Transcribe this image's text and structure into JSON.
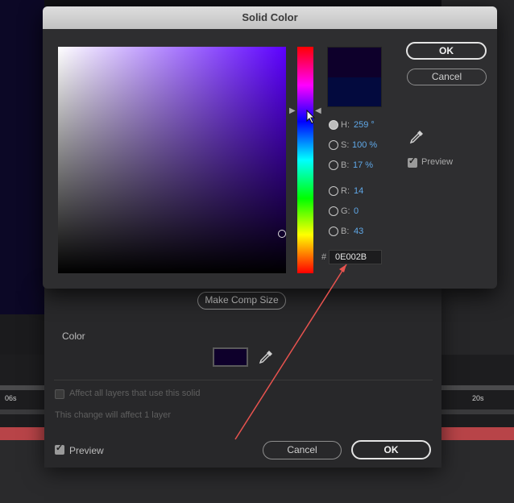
{
  "background": {
    "timeline": {
      "tick_start": "06s",
      "tick_end": "20s"
    }
  },
  "solid_settings": {
    "make_comp_size": "Make Comp Size",
    "color_label": "Color",
    "affect_all_label": "Affect all layers that use this solid",
    "change_note": "This change will affect 1 layer",
    "preview_label": "Preview",
    "cancel_label": "Cancel",
    "ok_label": "OK",
    "swatch_color": "#0e002b"
  },
  "solid_color": {
    "title": "Solid Color",
    "ok_label": "OK",
    "cancel_label": "Cancel",
    "preview_label": "Preview",
    "fields": {
      "h": {
        "label": "H:",
        "value": "259 °"
      },
      "s": {
        "label": "S:",
        "value": "100 %"
      },
      "b": {
        "label": "B:",
        "value": "17 %"
      },
      "r": {
        "label": "R:",
        "value": "14"
      },
      "g": {
        "label": "G:",
        "value": "0"
      },
      "b2": {
        "label": "B:",
        "value": "43"
      }
    },
    "hex_label": "#",
    "hex_value": "0E002B",
    "new_color": "#0e002b",
    "current_color": "#030a3e"
  },
  "colors": {
    "annotation_arrow": "#e8534f"
  }
}
